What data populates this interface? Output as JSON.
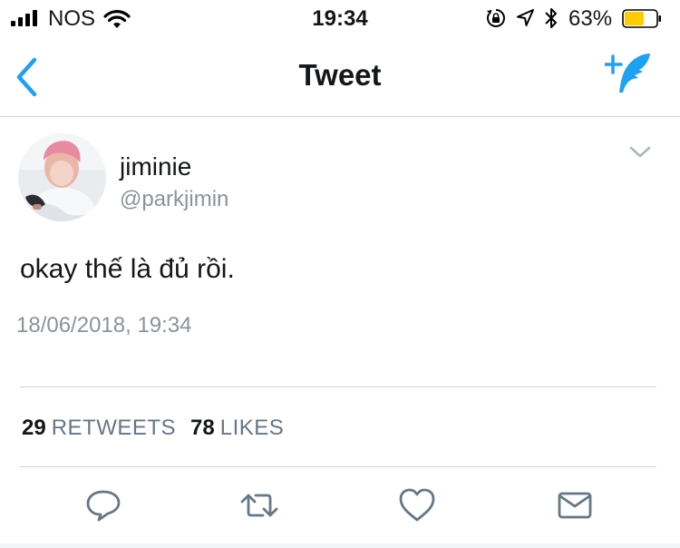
{
  "status_bar": {
    "carrier": "NOS",
    "time": "19:34",
    "battery_percent": "63%",
    "battery_level": 0.63,
    "battery_color": "#ffcc00",
    "icons": [
      "signal-icon",
      "wifi-icon",
      "rotation-lock-icon",
      "location-icon",
      "bluetooth-icon",
      "battery-icon"
    ]
  },
  "nav": {
    "title": "Tweet",
    "back_icon": "chevron-left-icon",
    "compose_icon": "compose-tweet-icon",
    "accent_color": "#1da1f2"
  },
  "tweet": {
    "display_name": "jiminie",
    "handle": "@parkjimin",
    "text": "okay thế là đủ rồi.",
    "timestamp": "18/06/2018, 19:34",
    "retweet_count": "29",
    "retweets_label": "RETWEETS",
    "like_count": "78",
    "likes_label": "LIKES"
  },
  "actions": [
    {
      "name": "reply",
      "icon": "reply-icon"
    },
    {
      "name": "retweet",
      "icon": "retweet-icon"
    },
    {
      "name": "like",
      "icon": "heart-icon"
    },
    {
      "name": "direct-message",
      "icon": "envelope-icon"
    }
  ]
}
